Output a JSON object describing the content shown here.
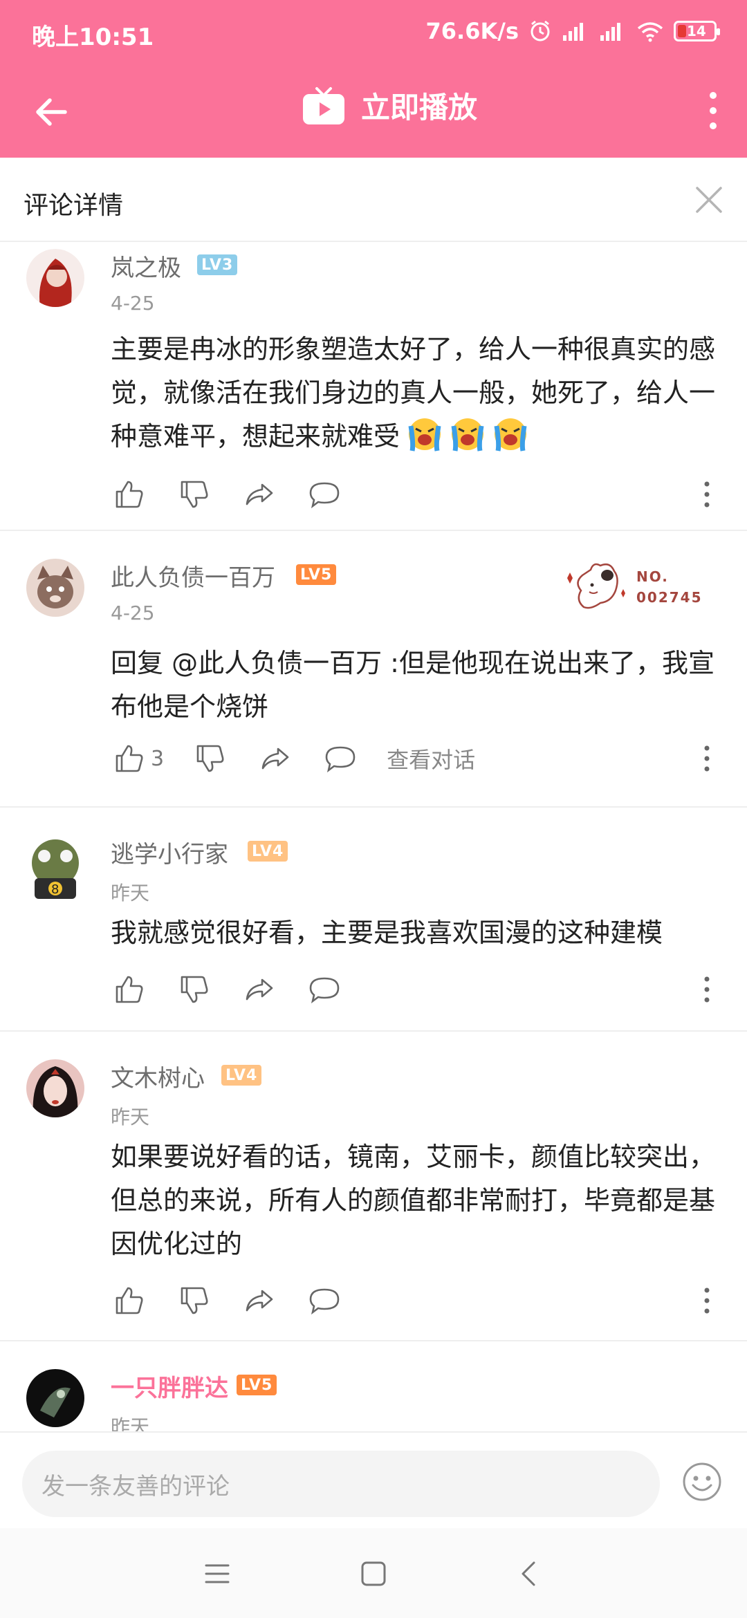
{
  "status_bar": {
    "time": "晚上10:51",
    "speed": "76.6K/s",
    "battery": "14"
  },
  "nav": {
    "title": "立即播放"
  },
  "panel": {
    "title": "评论详情"
  },
  "comments": [
    {
      "user": "岚之极",
      "level": "LV3",
      "level_color": "#8dcdea",
      "date": "4-25",
      "text": "主要是冉冰的形象塑造太好了，给人一种很真实的感觉，就像活在我们身边的真人一般，她死了，给人一种意难平，想起来就难受"
    },
    {
      "user": "此人负债一百万",
      "level": "LV5",
      "level_color": "#ff8a3d",
      "date": "4-25",
      "text": "回复 @此人负债一百万 :但是他现在说出来了，我宣布他是个烧饼",
      "likes": "3",
      "view_label": "查看对话",
      "fan_no_label": "NO.",
      "fan_no": "002745"
    },
    {
      "user": "逃学小行家",
      "level": "LV4",
      "level_color": "#ffc283",
      "date": "昨天",
      "text": "我就感觉很好看，主要是我喜欢国漫的这种建模"
    },
    {
      "user": "文木树心",
      "level": "LV4",
      "level_color": "#ffc283",
      "date": "昨天",
      "text": "如果要说好看的话，镜南，艾丽卡，颜值比较突出，但总的来说，所有人的颜值都非常耐打，毕竟都是基因优化过的"
    },
    {
      "user": "一只胖胖达",
      "level": "LV5",
      "level_color": "#ff8a3d",
      "date": "昨天"
    }
  ],
  "input": {
    "placeholder": "发一条友善的评论"
  },
  "colors": {
    "brand": "#fb7299"
  }
}
